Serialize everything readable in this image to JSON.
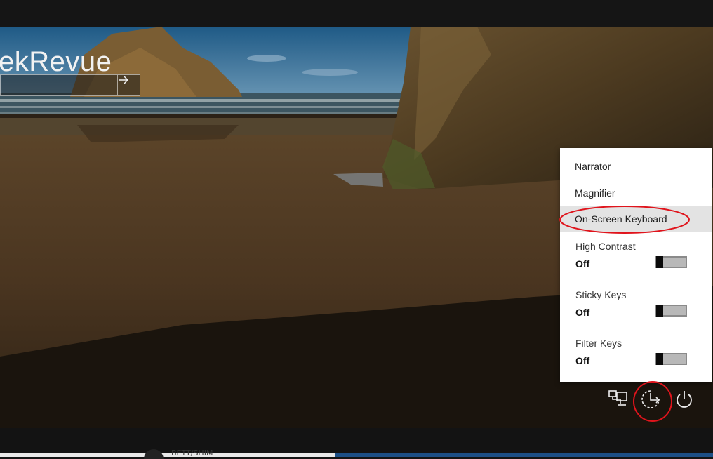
{
  "login": {
    "username_visible": "ekRevue",
    "submit_icon": "arrow-right-icon"
  },
  "ease_of_access_menu": {
    "items": [
      {
        "label": "Narrator"
      },
      {
        "label": "Magnifier"
      },
      {
        "label": "On-Screen Keyboard",
        "highlighted": true
      }
    ],
    "toggles": [
      {
        "label": "High Contrast",
        "state": "Off"
      },
      {
        "label": "Sticky Keys",
        "state": "Off"
      },
      {
        "label": "Filter Keys",
        "state": "Off"
      }
    ]
  },
  "system_icons": [
    "network-icon",
    "ease-of-access-icon",
    "power-icon"
  ],
  "taskbar_partial_text": "BETT/SHIM",
  "colors": {
    "menu_background": "#ffffff",
    "menu_highlight": "#e3e3e3",
    "annotation": "#e0141c",
    "taskbar_accent": "#1c4f86"
  }
}
